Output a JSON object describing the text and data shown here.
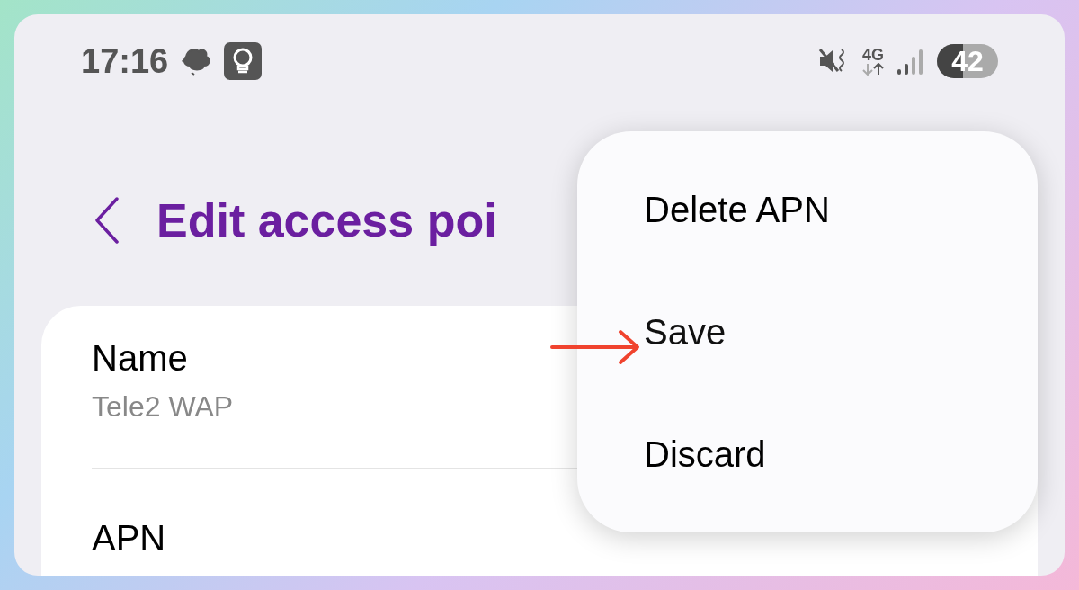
{
  "status_bar": {
    "time": "17:16",
    "network": "4G",
    "battery": {
      "text": "42",
      "level": 0.42
    }
  },
  "header": {
    "title": "Edit access poi"
  },
  "fields": [
    {
      "label": "Name",
      "value": "Tele2 WAP"
    },
    {
      "label": "APN"
    }
  ],
  "menu": {
    "items": [
      {
        "label": "Delete APN",
        "highlighted": false
      },
      {
        "label": "Save",
        "highlighted": true
      },
      {
        "label": "Discard",
        "highlighted": false
      }
    ]
  }
}
